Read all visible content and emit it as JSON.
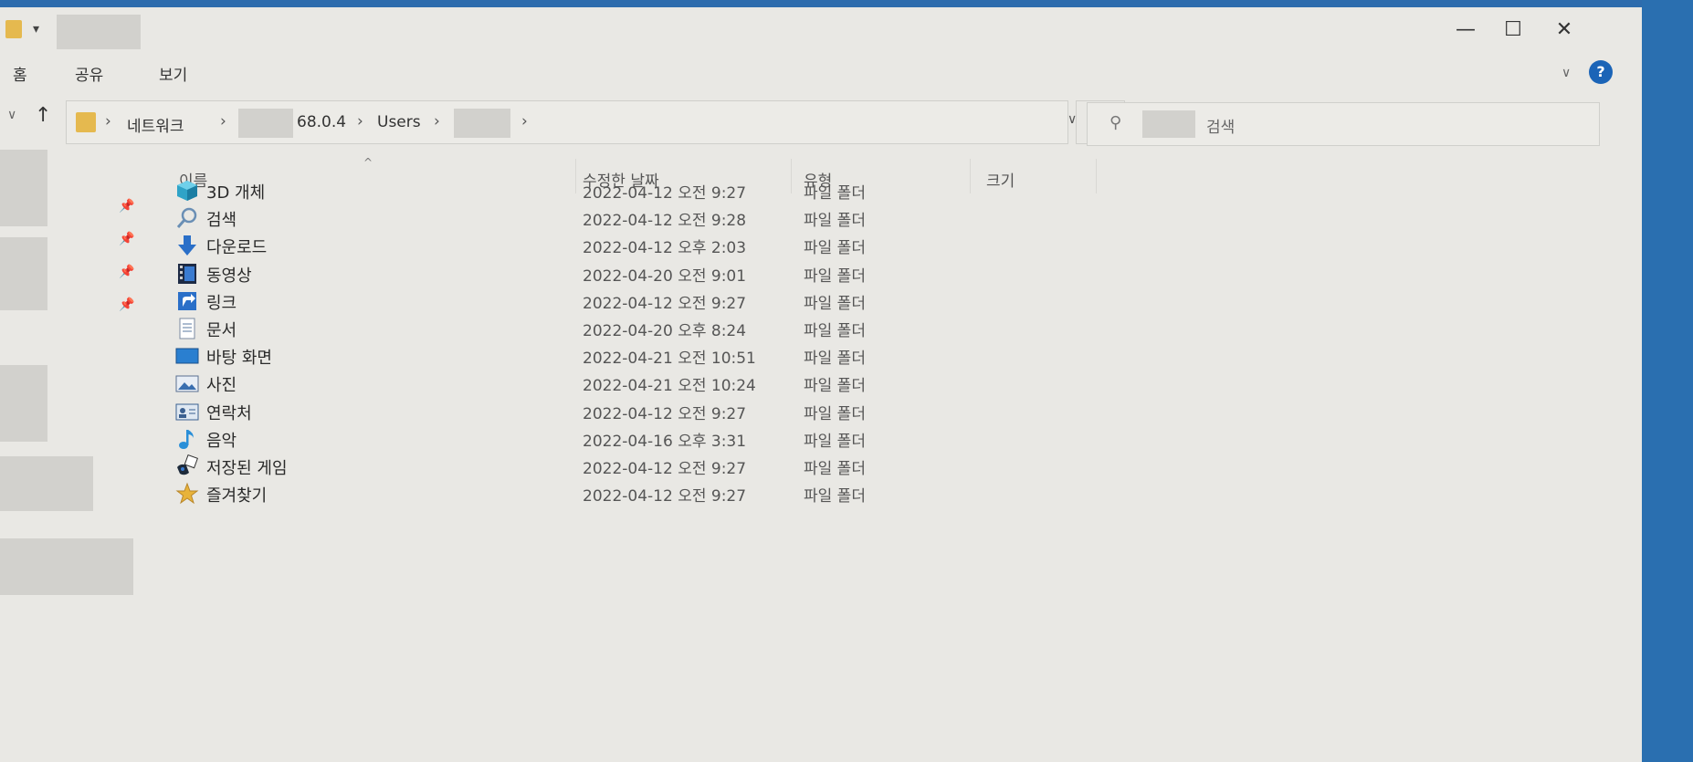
{
  "ribbon": {
    "tabs": [
      "홈",
      "공유",
      "보기"
    ]
  },
  "address": {
    "crumbs": [
      "네트워크",
      "68.0.4",
      "Users"
    ]
  },
  "search": {
    "placeholder": "검색"
  },
  "columns": {
    "name": "이름",
    "modified": "수정한 날짜",
    "type": "유형",
    "size": "크기"
  },
  "rows": [
    {
      "name": "3D 개체",
      "modified": "2022-04-12 오전 9:27",
      "type": "파일 폴더",
      "icon": "3d-objects-icon"
    },
    {
      "name": "검색",
      "modified": "2022-04-12 오전 9:28",
      "type": "파일 폴더",
      "icon": "search-folder-icon"
    },
    {
      "name": "다운로드",
      "modified": "2022-04-12 오후 2:03",
      "type": "파일 폴더",
      "icon": "download-icon"
    },
    {
      "name": "동영상",
      "modified": "2022-04-20 오전 9:01",
      "type": "파일 폴더",
      "icon": "video-icon"
    },
    {
      "name": "링크",
      "modified": "2022-04-12 오전 9:27",
      "type": "파일 폴더",
      "icon": "link-icon"
    },
    {
      "name": "문서",
      "modified": "2022-04-20 오후 8:24",
      "type": "파일 폴더",
      "icon": "document-icon"
    },
    {
      "name": "바탕 화면",
      "modified": "2022-04-21 오전 10:51",
      "type": "파일 폴더",
      "icon": "desktop-icon"
    },
    {
      "name": "사진",
      "modified": "2022-04-21 오전 10:24",
      "type": "파일 폴더",
      "icon": "pictures-icon"
    },
    {
      "name": "연락처",
      "modified": "2022-04-12 오전 9:27",
      "type": "파일 폴더",
      "icon": "contacts-icon"
    },
    {
      "name": "음악",
      "modified": "2022-04-16 오후 3:31",
      "type": "파일 폴더",
      "icon": "music-icon"
    },
    {
      "name": "저장된 게임",
      "modified": "2022-04-12 오전 9:27",
      "type": "파일 폴더",
      "icon": "saved-games-icon"
    },
    {
      "name": "즐겨찾기",
      "modified": "2022-04-12 오전 9:27",
      "type": "파일 폴더",
      "icon": "favorites-icon"
    }
  ],
  "colors": {
    "accent": "#2d6cad",
    "folder": "#e5b94f"
  }
}
